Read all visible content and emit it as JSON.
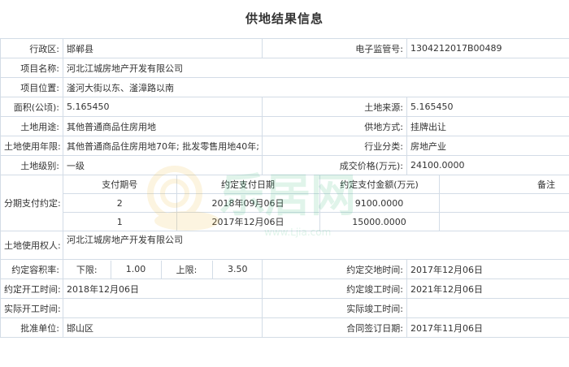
{
  "page_title": "供地结果信息",
  "watermark": {
    "brand": "乐居网",
    "url": "www.Ljia.com"
  },
  "fields": {
    "admin_region": {
      "label": "行政区:",
      "value": "邯郸县"
    },
    "e_supervision_no": {
      "label": "电子监管号:",
      "value": "1304212017B00489"
    },
    "project_name": {
      "label": "项目名称:",
      "value": "河北江城房地产开发有限公司"
    },
    "project_location": {
      "label": "项目位置:",
      "value": "滏河大街以东、滏漳路以南"
    },
    "area": {
      "label": "面积(公顷):",
      "value": "5.165450"
    },
    "land_source": {
      "label": "土地来源:",
      "value": "5.165450"
    },
    "land_use": {
      "label": "土地用途:",
      "value": "其他普通商品住房用地"
    },
    "supply_method": {
      "label": "供地方式:",
      "value": "挂牌出让"
    },
    "use_term": {
      "label": "土地使用年限:",
      "value": "其他普通商品住房用地70年; 批发零售用地40年;"
    },
    "industry": {
      "label": "行业分类:",
      "value": "房地产业"
    },
    "land_grade": {
      "label": "土地级别:",
      "value": "一级"
    },
    "deal_price": {
      "label": "成交价格(万元):",
      "value": "24100.0000"
    },
    "land_user": {
      "label": "土地使用权人:",
      "value": "河北江城房地产开发有限公司"
    },
    "plot_ratio": {
      "label": "约定容积率:",
      "lower_label": "下限:",
      "lower": "1.00",
      "upper_label": "上限:",
      "upper": "3.50"
    },
    "agreed_delivery": {
      "label": "约定交地时间:",
      "value": "2017年12月06日"
    },
    "agreed_start": {
      "label": "约定开工时间:",
      "value": "2018年12月06日"
    },
    "agreed_complete": {
      "label": "约定竣工时间:",
      "value": "2021年12月06日"
    },
    "actual_start": {
      "label": "实际开工时间:",
      "value": ""
    },
    "actual_complete": {
      "label": "实际竣工时间:",
      "value": ""
    },
    "approval_unit": {
      "label": "批准单位:",
      "value": "邯山区"
    },
    "contract_date": {
      "label": "合同签订日期:",
      "value": "2017年11月06日"
    }
  },
  "installments": {
    "label": "分期支付约定:",
    "headers": [
      "支付期号",
      "约定支付日期",
      "约定支付金额(万元)",
      "备注"
    ],
    "rows": [
      [
        "2",
        "2018年09月06日",
        "9100.0000",
        ""
      ],
      [
        "1",
        "2017年12月06日",
        "15000.0000",
        ""
      ]
    ]
  }
}
